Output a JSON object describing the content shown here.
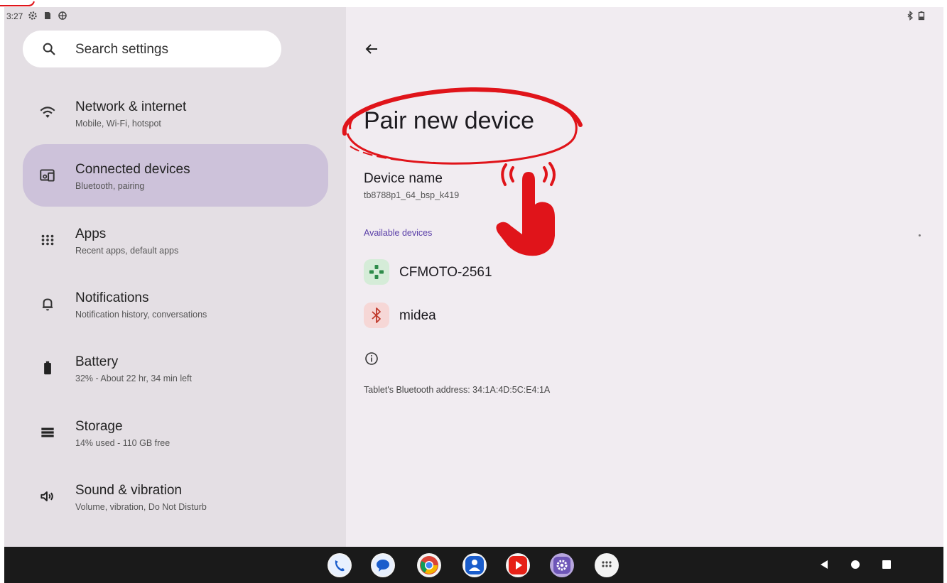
{
  "status_bar": {
    "time": "3:27",
    "left_icons": [
      "gear-icon",
      "sim-icon",
      "vpn-icon"
    ],
    "right_icons": [
      "bluetooth-icon",
      "battery-icon"
    ]
  },
  "search": {
    "placeholder": "Search settings"
  },
  "sidebar": {
    "items": [
      {
        "title": "Network & internet",
        "subtitle": "Mobile, Wi-Fi, hotspot",
        "icon": "wifi-icon",
        "selected": false
      },
      {
        "title": "Connected devices",
        "subtitle": "Bluetooth, pairing",
        "icon": "connected-devices-icon",
        "selected": true
      },
      {
        "title": "Apps",
        "subtitle": "Recent apps, default apps",
        "icon": "apps-grid-icon",
        "selected": false
      },
      {
        "title": "Notifications",
        "subtitle": "Notification history, conversations",
        "icon": "bell-icon",
        "selected": false
      },
      {
        "title": "Battery",
        "subtitle": "32% - About 22 hr, 34 min left",
        "icon": "battery-icon",
        "selected": false
      },
      {
        "title": "Storage",
        "subtitle": "14% used - 110 GB free",
        "icon": "storage-icon",
        "selected": false
      },
      {
        "title": "Sound & vibration",
        "subtitle": "Volume, vibration, Do Not Disturb",
        "icon": "volume-icon",
        "selected": false
      }
    ]
  },
  "detail": {
    "title": "Pair new device",
    "device_name_label": "Device name",
    "device_name_value": "tb8788p1_64_bsp_k419",
    "available_header": "Available devices",
    "devices": [
      {
        "name": "CFMOTO-2561",
        "icon": "gamepad-icon"
      },
      {
        "name": "midea",
        "icon": "bluetooth-icon"
      }
    ],
    "bt_address": "Tablet's Bluetooth address: 34:1A:4D:5C:E4:1A"
  },
  "dock": {
    "apps": [
      "phone-app-icon",
      "messages-app-icon",
      "chrome-app-icon",
      "contacts-app-icon",
      "youtube-app-icon",
      "settings-app-icon",
      "app-drawer-icon"
    ]
  },
  "colors": {
    "sidebar_bg": "#e4dfe4",
    "selected_bg": "#cdc2da",
    "content_bg": "#f1ecf1",
    "accent": "#5a3fa8",
    "annotation": "#e0141a",
    "navbar_bg": "#1a1a1a"
  }
}
